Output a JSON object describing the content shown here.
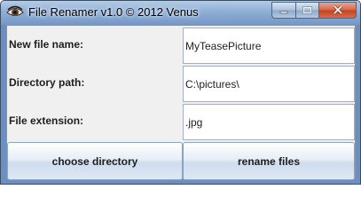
{
  "window": {
    "title": "File Renamer v1.0 © 2012 Venus",
    "icon": "eye-icon",
    "controls": [
      "minimize-icon",
      "maximize-icon",
      "close-icon"
    ]
  },
  "form": {
    "new_file_name": {
      "label": "New file name:",
      "value": "MyTeasePicture"
    },
    "directory_path": {
      "label": "Directory path:",
      "value": "C:\\pictures\\"
    },
    "file_extension": {
      "label": "File extension:",
      "value": ".jpg"
    }
  },
  "buttons": {
    "choose_directory": "choose directory",
    "rename_files": "rename files"
  },
  "colors": {
    "titlebar": "#8eaed6",
    "close_button": "#c4421f",
    "client_background": "#f0f0f0"
  }
}
